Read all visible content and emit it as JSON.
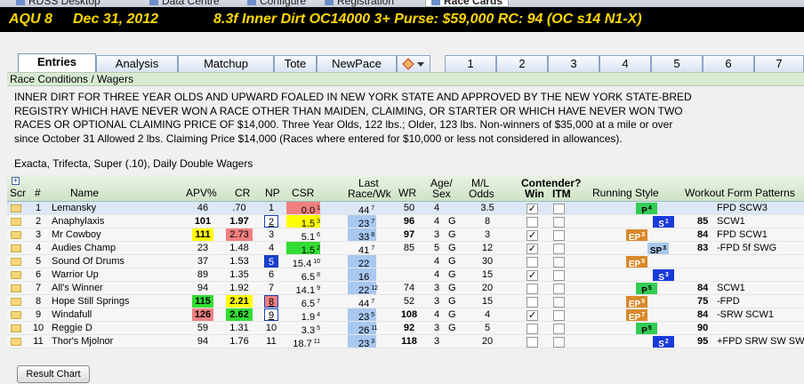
{
  "window_tabs": [
    "RDSS Desktop",
    "Data Centre",
    "Configure",
    "Registration",
    "Race Cards"
  ],
  "header": {
    "track_race": "AQU  8",
    "date": "Dec 31, 2012",
    "race_info": "8.3f  Inner Dirt  OC14000  3+   Purse: $59,000   RC: 94  (OC s14 N1-X)"
  },
  "tabs": {
    "entries": "Entries",
    "analysis": "Analysis",
    "matchup": "Matchup",
    "tote": "Tote",
    "newpace": "NewPace",
    "numbers": [
      "1",
      "2",
      "3",
      "4",
      "5",
      "6",
      "7"
    ]
  },
  "section_title": "Race Conditions / Wagers",
  "conditions": "INNER DIRT FOR THREE YEAR OLDS AND UPWARD FOALED IN NEW YORK STATE AND APPROVED BY THE NEW YORK STATE-BRED\nREGISTRY WHICH HAVE NEVER WON A RACE OTHER THAN MAIDEN, CLAIMING, OR STARTER OR WHICH HAVE NEVER WON TWO\nRACES OR OPTIONAL CLAIMING PRICE OF $14,000. Three Year Olds, 122 lbs.; Older, 123 lbs. Non-winners of $35,000 at a mile or over\nsince October 31 Allowed 2 lbs. Claiming Price $14,000 (Races where entered for $10,000 or less not considered in allowances).",
  "wagers": "Exacta, Trifecta, Super (.10), Daily Double Wagers",
  "columns": {
    "plus": "+",
    "scr": "Scr",
    "num": "#",
    "name": "Name",
    "apv": "APV%",
    "cr": "CR",
    "np": "NP",
    "csr": "CSR",
    "last_race": "Last",
    "last_race2": "Race/Wk",
    "wr": "WR",
    "age": "Age/",
    "sex": "Sex",
    "ml": "M/L",
    "odds": "Odds",
    "contender": "Contender?",
    "win": "Win",
    "itm": "ITM",
    "running_style": "Running Style",
    "workout": "Workout Form Patterns"
  },
  "runners": [
    {
      "num": "1",
      "name": "Lemansky",
      "apv": "46",
      "cr": ".70",
      "np": "1",
      "csr": "0.0",
      "csr_rank": "1",
      "last": "44",
      "last_wk": "7",
      "wr": "50",
      "age": "4",
      "sex": "",
      "ml": "3.5",
      "win": "✓",
      "style": "P",
      "style_n": "4",
      "pattern": "FPD  SCW3",
      "pattern_num": ""
    },
    {
      "num": "2",
      "name": "Anaphylaxis",
      "apv": "101",
      "cr": "1.97",
      "np": "2",
      "csr": "1.5",
      "csr_rank": "3",
      "last": "23",
      "last_wk": "7",
      "wr": "96",
      "age": "4",
      "sex": "G",
      "ml": "8",
      "win": "",
      "style": "S",
      "style_n": "1",
      "pattern": "SCW1",
      "pattern_num": "85"
    },
    {
      "num": "3",
      "name": "Mr Cowboy",
      "apv": "111",
      "cr": "2.73",
      "np": "3",
      "csr": "5.1",
      "csr_rank": "6",
      "last": "33",
      "last_wk": "8",
      "wr": "97",
      "age": "3",
      "sex": "G",
      "ml": "3",
      "win": "✓",
      "style": "EP",
      "style_n": "3",
      "pattern": "FPD  SCW1",
      "pattern_num": "84"
    },
    {
      "num": "4",
      "name": "Audies Champ",
      "apv": "23",
      "cr": "1.48",
      "np": "4",
      "csr": "1.5",
      "csr_rank": "2",
      "last": "41",
      "last_wk": "7",
      "wr": "85",
      "age": "5",
      "sex": "G",
      "ml": "12",
      "win": "✓",
      "style": "SP",
      "style_n": "3",
      "pattern": "-FPD  5f  SWG",
      "pattern_num": "83"
    },
    {
      "num": "5",
      "name": "Sound Of Drums",
      "apv": "37",
      "cr": "1.53",
      "np": "5",
      "csr": "15.4",
      "csr_rank": "10",
      "last": "22",
      "last_wk": "",
      "wr": "",
      "age": "4",
      "sex": "G",
      "ml": "30",
      "win": "",
      "style": "EP",
      "style_n": "5",
      "pattern": "",
      "pattern_num": ""
    },
    {
      "num": "6",
      "name": "Warrior Up",
      "apv": "89",
      "cr": "1.35",
      "np": "6",
      "csr": "6.5",
      "csr_rank": "8",
      "last": "16",
      "last_wk": "",
      "wr": "",
      "age": "4",
      "sex": "G",
      "ml": "15",
      "win": "✓",
      "style": "S",
      "style_n": "3",
      "pattern": "",
      "pattern_num": ""
    },
    {
      "num": "7",
      "name": "All's Winner",
      "apv": "94",
      "cr": "1.92",
      "np": "7",
      "csr": "14.1",
      "csr_rank": "9",
      "last": "22",
      "last_wk": "12",
      "wr": "74",
      "age": "3",
      "sex": "G",
      "ml": "20",
      "win": "",
      "style": "P",
      "style_n": "5",
      "pattern": "SCW1",
      "pattern_num": "84"
    },
    {
      "num": "8",
      "name": "Hope Still Springs",
      "apv": "115",
      "cr": "2.21",
      "np": "8",
      "csr": "6.5",
      "csr_rank": "7",
      "last": "44",
      "last_wk": "7",
      "wr": "52",
      "age": "3",
      "sex": "G",
      "ml": "15",
      "win": "",
      "style": "EP",
      "style_n": "5",
      "pattern": "-FPD",
      "pattern_num": "75"
    },
    {
      "num": "9",
      "name": "Windafull",
      "apv": "126",
      "cr": "2.62",
      "np": "9",
      "csr": "1.9",
      "csr_rank": "4",
      "last": "23",
      "last_wk": "5",
      "wr": "108",
      "age": "4",
      "sex": "G",
      "ml": "4",
      "win": "✓",
      "style": "EP",
      "style_n": "7",
      "pattern": "-SRW  SCW1",
      "pattern_num": "84"
    },
    {
      "num": "10",
      "name": "Reggie D",
      "apv": "59",
      "cr": "1.31",
      "np": "10",
      "csr": "3.3",
      "csr_rank": "5",
      "last": "26",
      "last_wk": "11",
      "wr": "92",
      "age": "3",
      "sex": "G",
      "ml": "5",
      "win": "",
      "style": "P",
      "style_n": "5",
      "pattern": "",
      "pattern_num": "90"
    },
    {
      "num": "11",
      "name": "Thor's Mjolnor",
      "apv": "94",
      "cr": "1.76",
      "np": "11",
      "csr": "18.7",
      "csr_rank": "11",
      "last": "23",
      "last_wk": "3",
      "wr": "118",
      "age": "3",
      "sex": "",
      "ml": "20",
      "win": "",
      "style": "S",
      "style_n": "2",
      "pattern": "+FPD  SRW  SW  SW",
      "pattern_num": "95"
    }
  ],
  "buttons": {
    "result_chart": "Result Chart"
  }
}
